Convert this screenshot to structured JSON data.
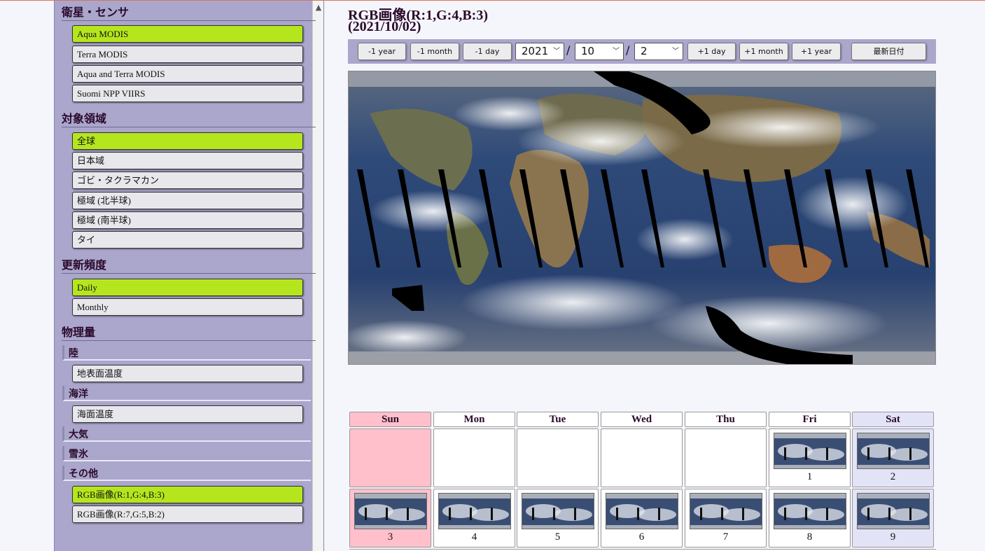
{
  "sidebar": {
    "sections": [
      {
        "title": "衛星・センサ"
      },
      {
        "title": "対象領域"
      },
      {
        "title": "更新頻度"
      },
      {
        "title": "物理量"
      }
    ],
    "satellite": [
      {
        "label": "Aqua MODIS",
        "active": true
      },
      {
        "label": "Terra MODIS",
        "active": false
      },
      {
        "label": "Aqua and Terra MODIS",
        "active": false
      },
      {
        "label": "Suomi NPP VIIRS",
        "active": false
      }
    ],
    "region": [
      {
        "label": "全球",
        "active": true
      },
      {
        "label": "日本域",
        "active": false
      },
      {
        "label": "ゴビ・タクラマカン",
        "active": false
      },
      {
        "label": "極域 (北半球)",
        "active": false
      },
      {
        "label": "極域 (南半球)",
        "active": false
      },
      {
        "label": "タイ",
        "active": false
      }
    ],
    "frequency": [
      {
        "label": "Daily",
        "active": true
      },
      {
        "label": "Monthly",
        "active": false
      }
    ],
    "physical": {
      "land": {
        "heading": "陸",
        "items": [
          "地表面温度"
        ]
      },
      "ocean": {
        "heading": "海洋",
        "items": [
          "海面温度"
        ]
      },
      "atmosphere": {
        "heading": "大気"
      },
      "snow_ice": {
        "heading": "雪氷"
      },
      "other": {
        "heading": "その他",
        "items": [
          "RGB画像(R:1,G:4,B:3)",
          "RGB画像(R:7,G:5,B:2)"
        ],
        "active_index": 0
      }
    }
  },
  "main": {
    "title_line1": "RGB画像(R:1,G:4,B:3)",
    "title_line2": "(2021/10/02)",
    "toolbar": {
      "minus_year": "-1 year",
      "minus_month": "-1 month",
      "minus_day": "-1 day",
      "year": "2021",
      "month": "10",
      "day": "2",
      "sep": "/",
      "plus_day": "+1 day",
      "plus_month": "+1 month",
      "plus_year": "+1 year",
      "latest": "最新日付"
    }
  },
  "calendar": {
    "weekdays": [
      "Sun",
      "Mon",
      "Tue",
      "Wed",
      "Thu",
      "Fri",
      "Sat"
    ],
    "rows": [
      [
        "",
        "",
        "",
        "",
        "",
        "1",
        "2"
      ],
      [
        "3",
        "4",
        "5",
        "6",
        "7",
        "8",
        "9"
      ]
    ]
  },
  "colors": {
    "sidebar_bg": "#aaa6cc",
    "active_btn": "#b5e61d",
    "sunday": "#ffc0cb",
    "saturday": "#e3e3f8"
  }
}
